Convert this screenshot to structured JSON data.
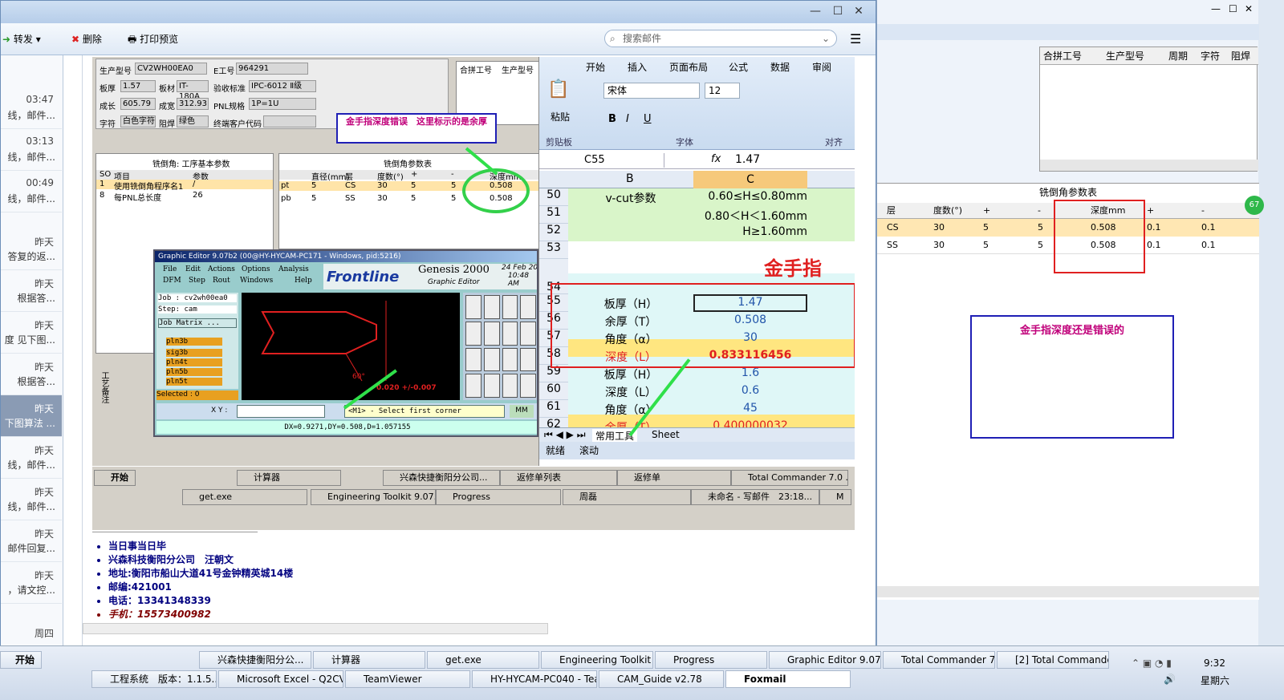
{
  "toolbar": {
    "forward": "转发",
    "delete": "删除",
    "print_preview": "打印预览",
    "search_placeholder": "搜索邮件"
  },
  "mail_list": [
    {
      "time": "03:47",
      "snippet": "线，邮件..."
    },
    {
      "time": "03:13",
      "snippet": "线，邮件..."
    },
    {
      "time": "00:49",
      "snippet": "线，邮件..."
    },
    {
      "time": "昨天",
      "snippet": "答复的返..."
    },
    {
      "time": "昨天",
      "snippet": "根据答..."
    },
    {
      "time": "昨天",
      "snippet": "度 见下图..."
    },
    {
      "time": "昨天",
      "snippet": "根据答..."
    },
    {
      "time": "昨天",
      "snippet": "下图算法 ..."
    },
    {
      "time": "昨天",
      "snippet": "线，邮件..."
    },
    {
      "time": "昨天",
      "snippet": "线，邮件..."
    },
    {
      "time": "昨天",
      "snippet": "邮件回复..."
    },
    {
      "time": "昨天",
      "snippet": "，请文控..."
    },
    {
      "time": "周四",
      "snippet": ""
    }
  ],
  "form": {
    "model_label": "生产型号",
    "model_value": "CV2WH00EA0",
    "eno_label": "E工号",
    "eno_value": "964291",
    "thick_label": "板厚",
    "thick_value": "1.57",
    "mat_label": "板材",
    "mat_value": "IT-180A",
    "std_label": "验收标准",
    "std_value": "IPC-6012 Ⅱ级",
    "len_label": "成长",
    "len_value": "605.79",
    "wid_label": "成宽",
    "wid_value": "312.93",
    "pnl_label": "PNL规格",
    "pnl_value": "1P=1U",
    "char_label": "字符",
    "char_value": "白色字符",
    "mask_label": "阻焊",
    "mask_value": "绿色",
    "cust_label": "终端客户代码",
    "merge_label": "合拼工号",
    "prod_label": "生产型号"
  },
  "mill_left": {
    "title": "铣倒角: 工序基本参数",
    "headers": [
      "SO",
      "项目",
      "参数"
    ],
    "rows": [
      [
        "1",
        "使用铣倒角程序名1",
        "/"
      ],
      [
        "8",
        "每PNL总长度",
        "26"
      ]
    ]
  },
  "mill_right": {
    "title": "铣倒角参数表",
    "headers": [
      "",
      "直径(mm)",
      "层",
      "度数(°)",
      "+",
      "-",
      "深度mm"
    ],
    "rows": [
      [
        "pt",
        "5",
        "CS",
        "30",
        "5",
        "5",
        "0.508"
      ],
      [
        "pb",
        "5",
        "SS",
        "30",
        "5",
        "5",
        "0.508"
      ]
    ]
  },
  "note1": "金手指深度错误　这里标示的是余厚",
  "note2": "金手指深度还是错误的",
  "side_label": "工艺备注",
  "excel": {
    "tabs": [
      "开始",
      "插入",
      "页面布局",
      "公式",
      "数据",
      "审阅"
    ],
    "font": "宋体",
    "size": "12",
    "paste": "粘贴",
    "group_clipboard": "剪贴板",
    "group_font": "字体",
    "group_align": "对齐",
    "namebox": "C55",
    "formula": "1.47",
    "col_b": "B",
    "col_c": "C",
    "rows": [
      {
        "n": "50",
        "b": "v-cut参数",
        "c": "0.60≤H≤0.80mm"
      },
      {
        "n": "51",
        "b": "",
        "c": "0.80＜H＜1.60mm"
      },
      {
        "n": "52",
        "b": "",
        "c": "H≥1.60mm"
      },
      {
        "n": "53",
        "b": "",
        "c": ""
      },
      {
        "n": "54",
        "b": "",
        "c": ""
      },
      {
        "n": "55",
        "b": "板厚（H）",
        "c": "1.47"
      },
      {
        "n": "56",
        "b": "余厚（T）",
        "c": "0.508"
      },
      {
        "n": "57",
        "b": "角度（α）",
        "c": "30"
      },
      {
        "n": "58",
        "b": "深度（L）",
        "c": "0.833116456"
      },
      {
        "n": "59",
        "b": "板厚（H）",
        "c": "1.6"
      },
      {
        "n": "60",
        "b": "深度（L）",
        "c": "0.6"
      },
      {
        "n": "61",
        "b": "角度（α）",
        "c": "45"
      },
      {
        "n": "62",
        "b": "余厚（T）",
        "c": "0.400000032"
      }
    ],
    "big_title": "金手指",
    "sheet_tabs": [
      "常用工具",
      "Sheet"
    ],
    "status_ready": "就绪",
    "status_scroll": "滚动"
  },
  "genesis": {
    "title": "Graphic Editor 9.07b2 (00@HY-HYCAM-PC171 - Windows, pid:5216)",
    "menu1": [
      "File",
      "Edit",
      "Actions",
      "Options",
      "Analysis"
    ],
    "menu2": [
      "DFM",
      "Step",
      "Rout",
      "Windows",
      "Help"
    ],
    "brand": "Frontline",
    "product": "Genesis 2000",
    "subtitle": "Graphic Editor",
    "date": "24 Feb 20",
    "time": "10:48 AM",
    "job": "Job : cv2wh00ea0",
    "step": "Step: cam",
    "matrix": "Job Matrix ...",
    "layers": [
      "pln3b",
      "sig3b",
      "pln4t",
      "pln5b",
      "pln5t"
    ],
    "selected": "Selected : 0",
    "angle": "60°",
    "dim": "0.020 +/-0.007",
    "xy": "X Y :",
    "prompt": "<M1> - Select first corner",
    "mm": "MM",
    "readout": "DX=0.9271,DY=0.508,D=1.057155"
  },
  "inner_taskbar": {
    "start": "开始",
    "row1": [
      "计算器",
      "兴森快捷衡阳分公司...",
      "返修单列表",
      "返修单",
      "Total Commander 7.0 ..."
    ],
    "row2": [
      "get.exe",
      "Engineering Toolkit 9.07...",
      "Progress",
      "周磊",
      "未命名 - 写邮件　23:18...",
      "M"
    ]
  },
  "signature": [
    "当日事当日毕",
    "兴森科技衡阳分公司　汪朝文",
    "地址:衡阳市船山大道41号金钟精英城14楼",
    "邮编:421001",
    "电话：13341348339",
    "手机：15573400982"
  ],
  "right_win": {
    "headers": [
      "合拼工号",
      "生产型号",
      "周期",
      "字符",
      "阻焊"
    ],
    "mill_title": "铣倒角参数表",
    "mill_headers": [
      "层",
      "度数(°)",
      "+",
      "-",
      "深度mm",
      "+",
      "-"
    ],
    "mill_rows": [
      [
        "CS",
        "30",
        "5",
        "5",
        "0.508",
        "0.1",
        "0.1"
      ],
      [
        "SS",
        "30",
        "5",
        "5",
        "0.508",
        "0.1",
        "0.1"
      ]
    ],
    "badge": "67"
  },
  "sys_taskbar": {
    "start": "开始",
    "row1": [
      "兴森快捷衡阳分公...",
      "计算器",
      "get.exe",
      "Engineering Toolkit 9....",
      "Progress",
      "Graphic Editor 9.07b2...",
      "Total Commander 7.0...",
      "[2] Total Commander..."
    ],
    "row2": [
      "工程系统　版本：1.1.5...",
      "Microsoft Excel - Q2CV2...",
      "TeamViewer",
      "HY-HYCAM-PC040 - Tea...",
      "CAM_Guide v2.78",
      "Foxmail"
    ],
    "clock": "9:32",
    "weekday": "星期六"
  }
}
